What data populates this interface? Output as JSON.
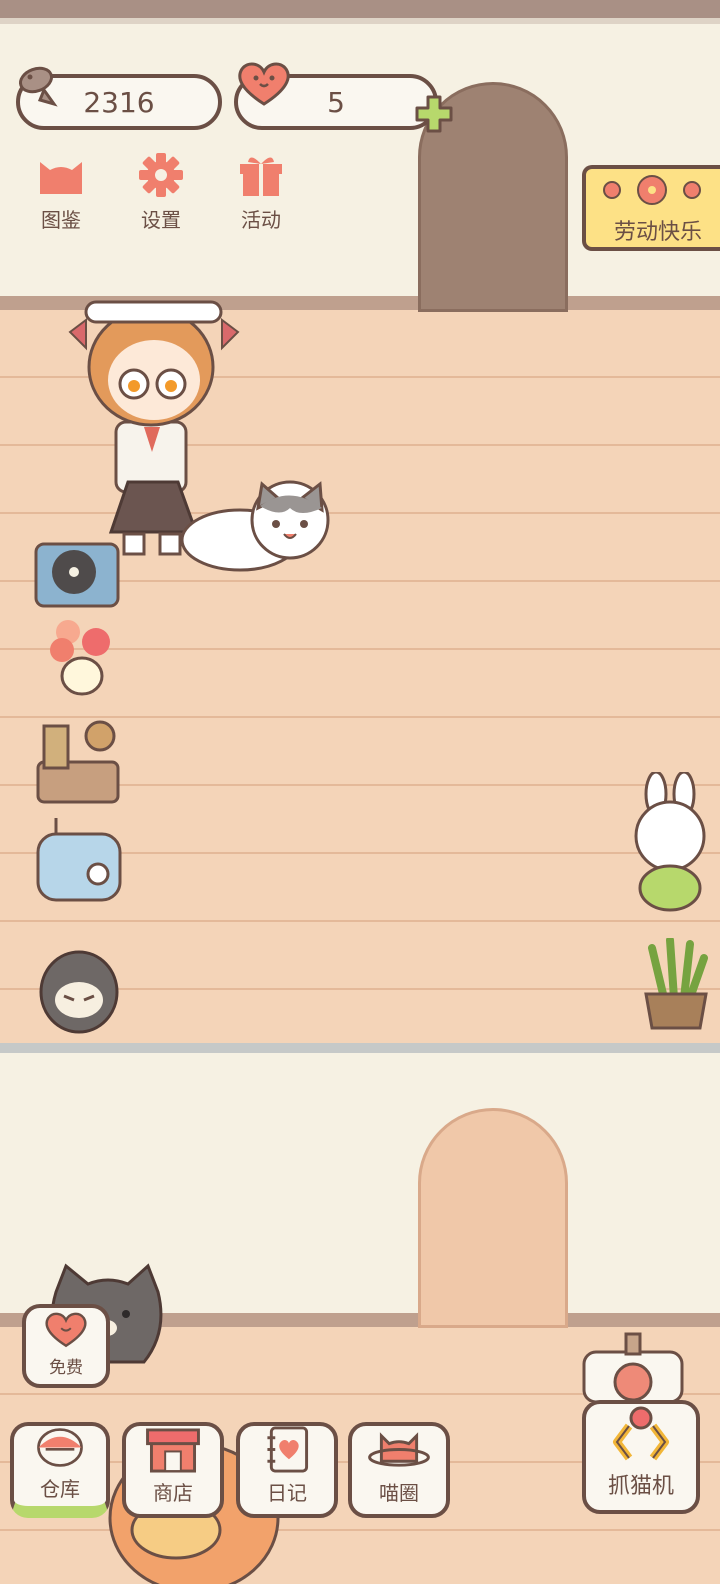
{
  "hud": {
    "fish_count": "2316",
    "heart_count": "5"
  },
  "top_menu": [
    {
      "label": "图鉴",
      "icon": "cat-face-icon"
    },
    {
      "label": "设置",
      "icon": "gear-icon"
    },
    {
      "label": "活动",
      "icon": "gift-icon"
    }
  ],
  "event_banner": {
    "label": "劳动快乐",
    "icon": "flower-icon"
  },
  "free_button": {
    "label": "免费",
    "icon": "heart-icon"
  },
  "bottom_nav": [
    {
      "label": "仓库",
      "icon": "storage-icon"
    },
    {
      "label": "商店",
      "icon": "shop-icon"
    },
    {
      "label": "日记",
      "icon": "diary-icon"
    },
    {
      "label": "喵圈",
      "icon": "planet-cat-icon"
    }
  ],
  "claw_machine": {
    "label": "抓猫机",
    "icon": "claw-icon"
  },
  "colors": {
    "outline": "#6b4f45",
    "accent_pink": "#f07f6d",
    "banner_yellow": "#fde186",
    "plus_green": "#b7d86c"
  }
}
